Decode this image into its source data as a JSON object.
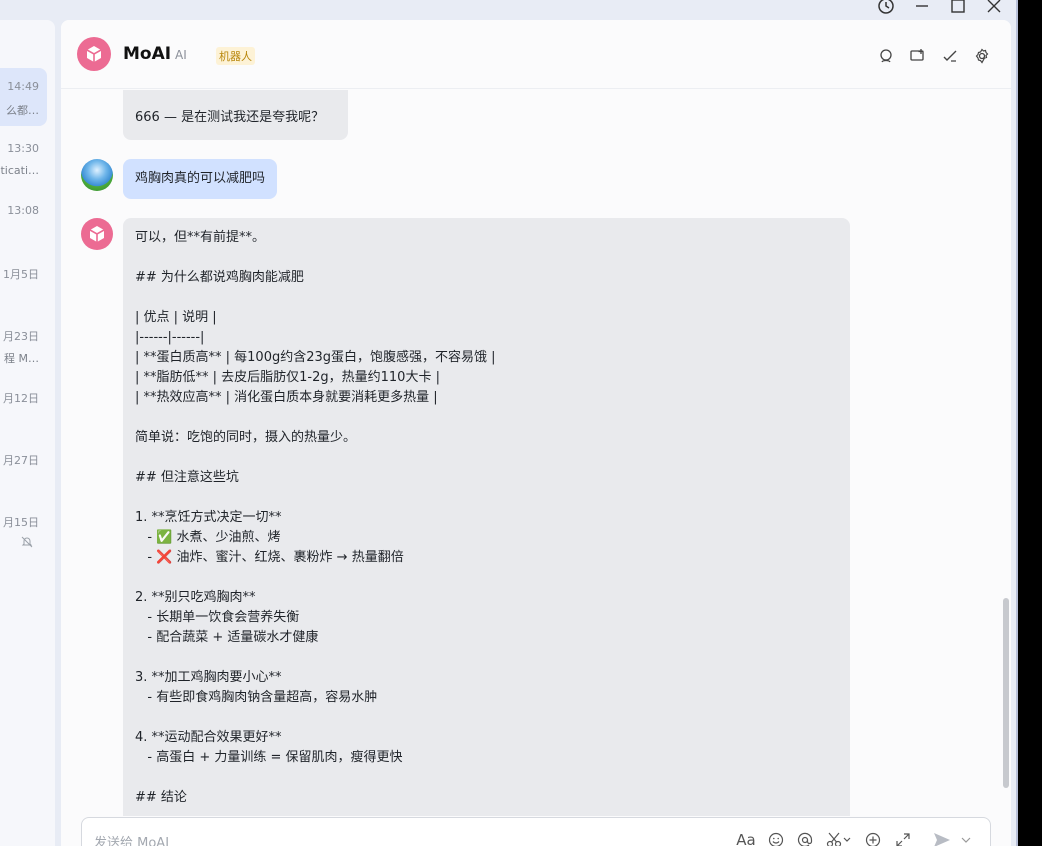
{
  "window": {
    "controls": [
      "history-icon",
      "minimize-icon",
      "maximize-icon",
      "close-icon"
    ]
  },
  "sidebar": {
    "items": [
      {
        "time": "14:49",
        "preview": "么都…",
        "active": true
      },
      {
        "time": "13:30",
        "preview": "ticati…"
      },
      {
        "time": "13:08",
        "preview": ""
      },
      {
        "time": "1月5日",
        "preview": ""
      },
      {
        "time": "月23日",
        "preview": "程 M…"
      },
      {
        "time": "月12日",
        "preview": ""
      },
      {
        "time": "月27日",
        "preview": ""
      },
      {
        "time": "月15日",
        "preview": "",
        "muted": true
      }
    ]
  },
  "header": {
    "title": "MoAI",
    "ai_label": "AI",
    "tag": "机器人",
    "icons": [
      "search-chat-icon",
      "add-chat-icon",
      "check-edit-icon",
      "settings-icon"
    ]
  },
  "messages": {
    "m1": {
      "sender": "bot",
      "text": "666 — 是在测试我还是夸我呢？"
    },
    "m2": {
      "sender": "user",
      "text": "鸡胸肉真的可以减肥吗"
    },
    "m3": {
      "sender": "bot",
      "lines": [
        "可以，但**有前提**。",
        "",
        "## 为什么都说鸡胸肉能减肥",
        "",
        "| 优点 | 说明 |",
        "|------|------|",
        "| **蛋白质高** | 每100g约含23g蛋白，饱腹感强，不容易饿 |",
        "| **脂肪低** | 去皮后脂肪仅1-2g，热量约110大卡 |",
        "| **热效应高** | 消化蛋白质本身就要消耗更多热量 |",
        "",
        "简单说：吃饱的同时，摄入的热量少。",
        "",
        "## 但注意这些坑",
        "",
        "1. **烹饪方式决定一切**",
        "   - ✅ 水煮、少油煎、烤",
        "   - ❌ 油炸、蜜汁、红烧、裹粉炸 → 热量翻倍",
        "",
        "2. **别只吃鸡胸肉**",
        "   - 长期单一饮食会营养失衡",
        "   - 配合蔬菜 + 适量碳水才健康",
        "",
        "3. **加工鸡胸肉要小心**",
        "   - 有些即食鸡胸肉钠含量超高，容易水肿",
        "",
        "4. **运动配合效果更好**",
        "   - 高蛋白 + 力量训练 = 保留肌肉，瘦得更快",
        "",
        "## 结论"
      ]
    }
  },
  "input": {
    "placeholder": "发送给 MoAI",
    "tools": [
      "font-icon",
      "emoji-icon",
      "mention-icon",
      "scissors-icon",
      "add-icon",
      "expand-icon",
      "send-icon",
      "chevron-down-icon"
    ],
    "font_label": "Aa"
  },
  "colors": {
    "accent_avatar": "#ec6b93",
    "user_bubble": "#d1e1ff",
    "bot_bubble": "#e9eaed",
    "tag_bg": "#fdf2d6"
  }
}
